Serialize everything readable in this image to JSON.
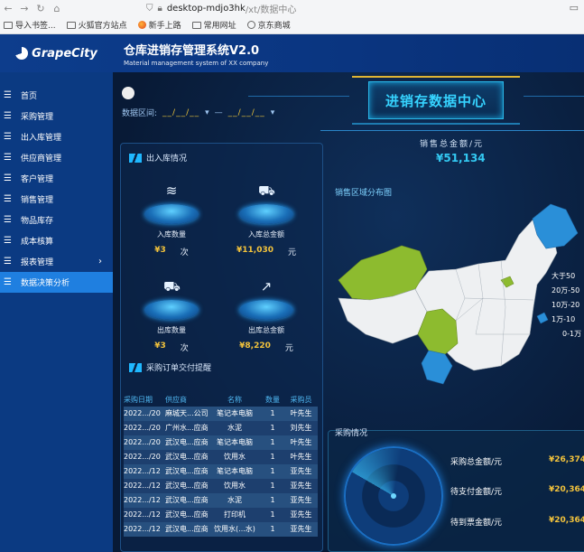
{
  "browser": {
    "host": "desktop-mdjo3hk",
    "path": "/xt/数据中心",
    "bookmarks": [
      {
        "label": "导入书签..."
      },
      {
        "label": "火狐官方站点"
      },
      {
        "label": "新手上路"
      },
      {
        "label": "常用网址"
      },
      {
        "label": "京东商城"
      }
    ]
  },
  "app": {
    "logo": "GrapeCity",
    "title": "仓库进销存管理系统V2.0",
    "subtitle": "Material management system of XX company"
  },
  "sidebar": {
    "items": [
      {
        "label": "首页"
      },
      {
        "label": "采购管理"
      },
      {
        "label": "出入库管理"
      },
      {
        "label": "供应商管理"
      },
      {
        "label": "客户管理"
      },
      {
        "label": "销售管理"
      },
      {
        "label": "物品库存"
      },
      {
        "label": "成本核算"
      },
      {
        "label": "报表管理"
      },
      {
        "label": "数据决策分析"
      }
    ]
  },
  "dashboard": {
    "date_label": "数据区间:",
    "date_from": "__/__/__",
    "date_sep": "—",
    "date_to": "__/__/__",
    "title": "进销存数据中心",
    "total_label": "销售总金额/元",
    "total_value": "¥51,134",
    "inout_title": "出入库情况",
    "stats": [
      {
        "label": "入库数量",
        "value": "¥3",
        "unit": "次"
      },
      {
        "label": "入库总金额",
        "value": "¥11,030",
        "unit": "元"
      },
      {
        "label": "出库数量",
        "value": "¥3",
        "unit": "次"
      },
      {
        "label": "出库总金额",
        "value": "¥8,220",
        "unit": "元"
      }
    ],
    "order_title": "采购订单交付提醒",
    "table": {
      "headers": [
        "采购日期",
        "供应商",
        "名称",
        "数量",
        "采购员"
      ],
      "rows": [
        [
          "2022.../20",
          "麻城天...公司",
          "笔记本电脑",
          "1",
          "叶先生"
        ],
        [
          "2022.../20",
          "广州水...应商",
          "水泥",
          "1",
          "刘先生"
        ],
        [
          "2022.../20",
          "武汉电...应商",
          "笔记本电脑",
          "1",
          "叶先生"
        ],
        [
          "2022.../20",
          "武汉电...应商",
          "饮用水",
          "1",
          "叶先生"
        ],
        [
          "2022.../12",
          "武汉电...应商",
          "笔记本电脑",
          "1",
          "亚先生"
        ],
        [
          "2022.../12",
          "武汉电...应商",
          "饮用水",
          "1",
          "亚先生"
        ],
        [
          "2022.../12",
          "武汉电...应商",
          "水泥",
          "1",
          "亚先生"
        ],
        [
          "2022.../12",
          "武汉电...应商",
          "打印机",
          "1",
          "亚先生"
        ],
        [
          "2022.../12",
          "武汉电...应商",
          "饮用水(...水)",
          "1",
          "亚先生"
        ]
      ]
    },
    "map_title": "销售区域分布图",
    "legend": [
      "大于50",
      "20万-50",
      "10万-20",
      "1万-10",
      "0-1万"
    ],
    "map_colors": {
      "base": "#eef0f2",
      "green": "#8dbb2f",
      "blue": "#2a8fd8"
    },
    "buy_title": "采购情况",
    "buy": [
      {
        "label": "采购总金额/元",
        "value": "¥26,374"
      },
      {
        "label": "待支付金额/元",
        "value": "¥20,364"
      },
      {
        "label": "待到票金额/元",
        "value": "¥20,364"
      }
    ]
  }
}
